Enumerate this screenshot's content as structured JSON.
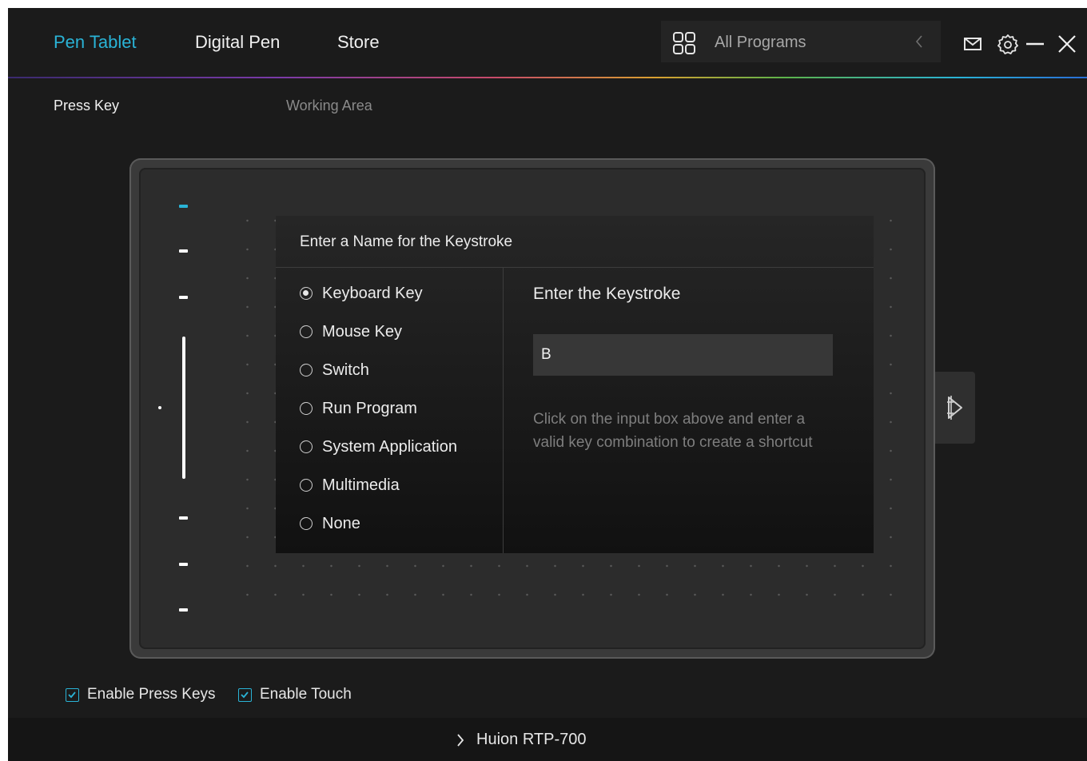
{
  "header": {
    "tabs": [
      {
        "label": "Pen Tablet",
        "active": true
      },
      {
        "label": "Digital Pen",
        "active": false
      },
      {
        "label": "Store",
        "active": false
      }
    ],
    "program_select": {
      "value": "All Programs"
    }
  },
  "icons": {
    "program_select": "grid-icon",
    "collapse": "chevron-left-icon",
    "mail": "mail-icon",
    "settings": "gear-icon",
    "minimize": "minimize-icon",
    "close": "close-icon",
    "side_panel": "pen-tablet-icon",
    "device_expand": "chevron-right-icon"
  },
  "subtabs": [
    {
      "label": "Press Key",
      "active": true
    },
    {
      "label": "Working Area",
      "active": false
    }
  ],
  "dialog": {
    "title": "Enter a Name for the Keystroke",
    "options": [
      {
        "label": "Keyboard Key",
        "selected": true
      },
      {
        "label": "Mouse Key",
        "selected": false
      },
      {
        "label": "Switch",
        "selected": false
      },
      {
        "label": "Run Program",
        "selected": false
      },
      {
        "label": "System Application",
        "selected": false
      },
      {
        "label": "Multimedia",
        "selected": false
      },
      {
        "label": "None",
        "selected": false
      }
    ],
    "keystroke_title": "Enter the Keystroke",
    "keystroke_value": "B",
    "help_text": "Click on the input box above and enter a valid key combination to create a shortcut"
  },
  "checkboxes": [
    {
      "label": "Enable Press Keys",
      "checked": true
    },
    {
      "label": "Enable Touch",
      "checked": true
    }
  ],
  "footer": {
    "device_name": "Huion RTP-700"
  },
  "colors": {
    "accent": "#2ab3d6",
    "background": "#1b1b1b",
    "dialog": "#1a1a1a",
    "input": "#373737",
    "footer": "#151515"
  }
}
